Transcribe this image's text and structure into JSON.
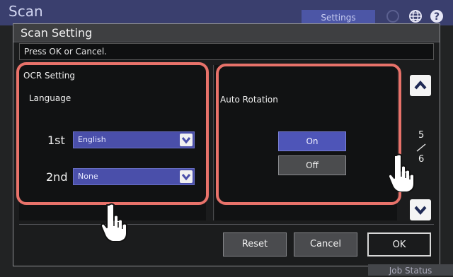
{
  "header": {
    "app_title": "Scan",
    "settings_tab": "Settings",
    "job_status": "Job Status"
  },
  "dialog": {
    "title": "Scan Setting",
    "message": "Press OK or Cancel.",
    "ocr": {
      "heading": "OCR Setting",
      "language_label": "Language",
      "first_label": "1st",
      "first_value": "English",
      "second_label": "2nd",
      "second_value": "None"
    },
    "auto_rotation": {
      "label": "Auto Rotation",
      "on": "On",
      "off": "Off",
      "selected": "On"
    },
    "pager": {
      "current": "5",
      "total": "6"
    },
    "buttons": {
      "reset": "Reset",
      "cancel": "Cancel",
      "ok": "OK"
    }
  },
  "colors": {
    "highlight": "#e8726a",
    "accent": "#4e55b8",
    "header": "#3a3f6e"
  },
  "icons": [
    "globe-icon",
    "help-icon",
    "up-arrow-icon",
    "down-arrow-icon",
    "chevron-down-icon",
    "pointing-hand-icon"
  ]
}
